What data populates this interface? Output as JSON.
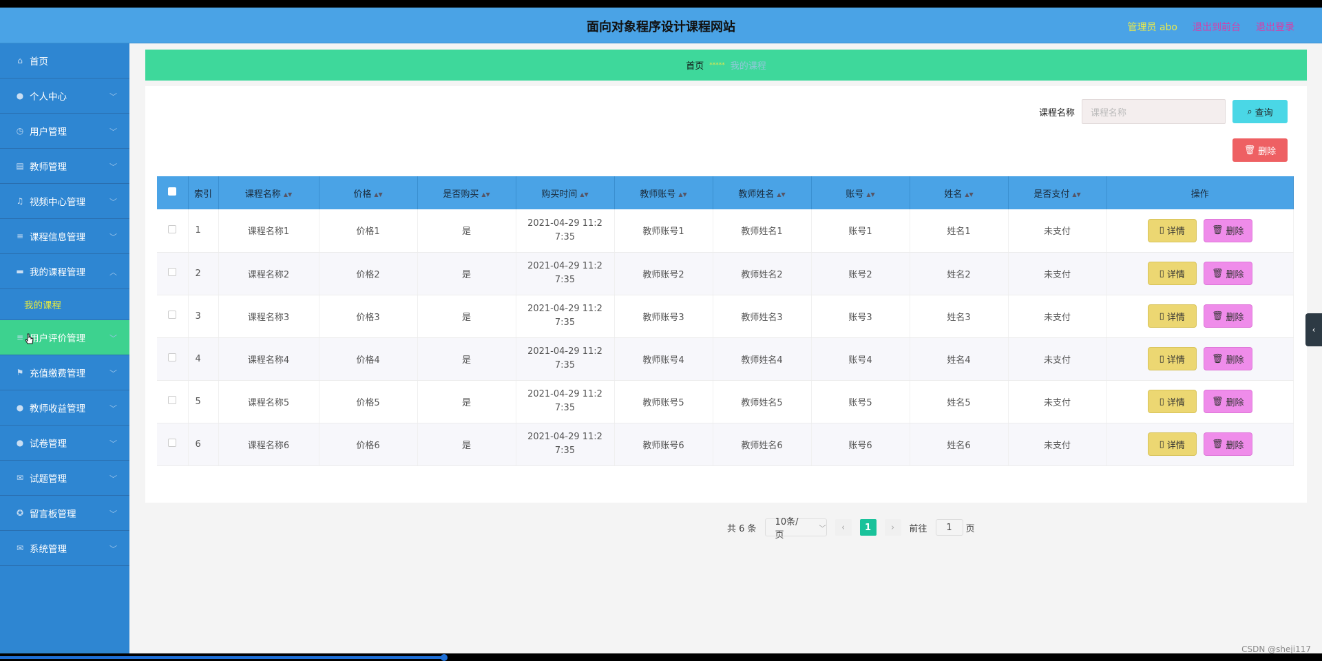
{
  "header": {
    "title": "面向对象程序设计课程网站",
    "admin": "管理员 abo",
    "to_front": "退出到前台",
    "logout": "退出登录"
  },
  "sidebar": {
    "items": [
      {
        "label": "首页",
        "icon": "home-icon"
      },
      {
        "label": "个人中心",
        "icon": "user-icon"
      },
      {
        "label": "用户管理",
        "icon": "clock-icon"
      },
      {
        "label": "教师管理",
        "icon": "briefcase-icon"
      },
      {
        "label": "视频中心管理",
        "icon": "bell-icon"
      },
      {
        "label": "课程信息管理",
        "icon": "list-icon"
      },
      {
        "label": "我的课程管理",
        "icon": "ticket-icon"
      },
      {
        "label": "我的课程",
        "icon": ""
      },
      {
        "label": "用户评价管理",
        "icon": "list-icon"
      },
      {
        "label": "充值缴费管理",
        "icon": "flag-icon"
      },
      {
        "label": "教师收益管理",
        "icon": "mic-icon"
      },
      {
        "label": "试卷管理",
        "icon": "mic-icon"
      },
      {
        "label": "试题管理",
        "icon": "mail-icon"
      },
      {
        "label": "留言板管理",
        "icon": "globe-icon"
      },
      {
        "label": "系统管理",
        "icon": "mail-icon"
      }
    ]
  },
  "breadcrumb": {
    "home": "首页",
    "sep": "*****",
    "current": "我的课程"
  },
  "search": {
    "label": "课程名称",
    "placeholder": "课程名称",
    "query_btn": "查询",
    "delete_btn": "删除"
  },
  "table": {
    "columns": [
      "索引",
      "课程名称",
      "价格",
      "是否购买",
      "购买时间",
      "教师账号",
      "教师姓名",
      "账号",
      "姓名",
      "是否支付",
      "操作"
    ],
    "rows": [
      {
        "idx": "1",
        "name": "课程名称1",
        "price": "价格1",
        "bought": "是",
        "time": "2021-04-29 11:27:35",
        "tacc": "教师账号1",
        "tname": "教师姓名1",
        "acc": "账号1",
        "xname": "姓名1",
        "paid": "未支付"
      },
      {
        "idx": "2",
        "name": "课程名称2",
        "price": "价格2",
        "bought": "是",
        "time": "2021-04-29 11:27:35",
        "tacc": "教师账号2",
        "tname": "教师姓名2",
        "acc": "账号2",
        "xname": "姓名2",
        "paid": "未支付"
      },
      {
        "idx": "3",
        "name": "课程名称3",
        "price": "价格3",
        "bought": "是",
        "time": "2021-04-29 11:27:35",
        "tacc": "教师账号3",
        "tname": "教师姓名3",
        "acc": "账号3",
        "xname": "姓名3",
        "paid": "未支付"
      },
      {
        "idx": "4",
        "name": "课程名称4",
        "price": "价格4",
        "bought": "是",
        "time": "2021-04-29 11:27:35",
        "tacc": "教师账号4",
        "tname": "教师姓名4",
        "acc": "账号4",
        "xname": "姓名4",
        "paid": "未支付"
      },
      {
        "idx": "5",
        "name": "课程名称5",
        "price": "价格5",
        "bought": "是",
        "time": "2021-04-29 11:27:35",
        "tacc": "教师账号5",
        "tname": "教师姓名5",
        "acc": "账号5",
        "xname": "姓名5",
        "paid": "未支付"
      },
      {
        "idx": "6",
        "name": "课程名称6",
        "price": "价格6",
        "bought": "是",
        "time": "2021-04-29 11:27:35",
        "tacc": "教师账号6",
        "tname": "教师姓名6",
        "acc": "账号6",
        "xname": "姓名6",
        "paid": "未支付"
      }
    ],
    "detail_btn": "详情",
    "delete_btn": "删除"
  },
  "pager": {
    "total": "共 6 条",
    "page_size": "10条/页",
    "current": "1",
    "goto_prefix": "前往",
    "goto_value": "1",
    "goto_suffix": "页"
  },
  "watermark": "CSDN @sheji117",
  "colors": {
    "header": "#4aa3e6",
    "sidebar": "#2e86d2",
    "active": "#3dd28f",
    "breadcrumb": "#3ed89b",
    "query": "#4ad7e6",
    "delete": "#ee6063",
    "detail": "#ecd772",
    "row_delete": "#ef8cea",
    "page_active": "#19c29a"
  }
}
